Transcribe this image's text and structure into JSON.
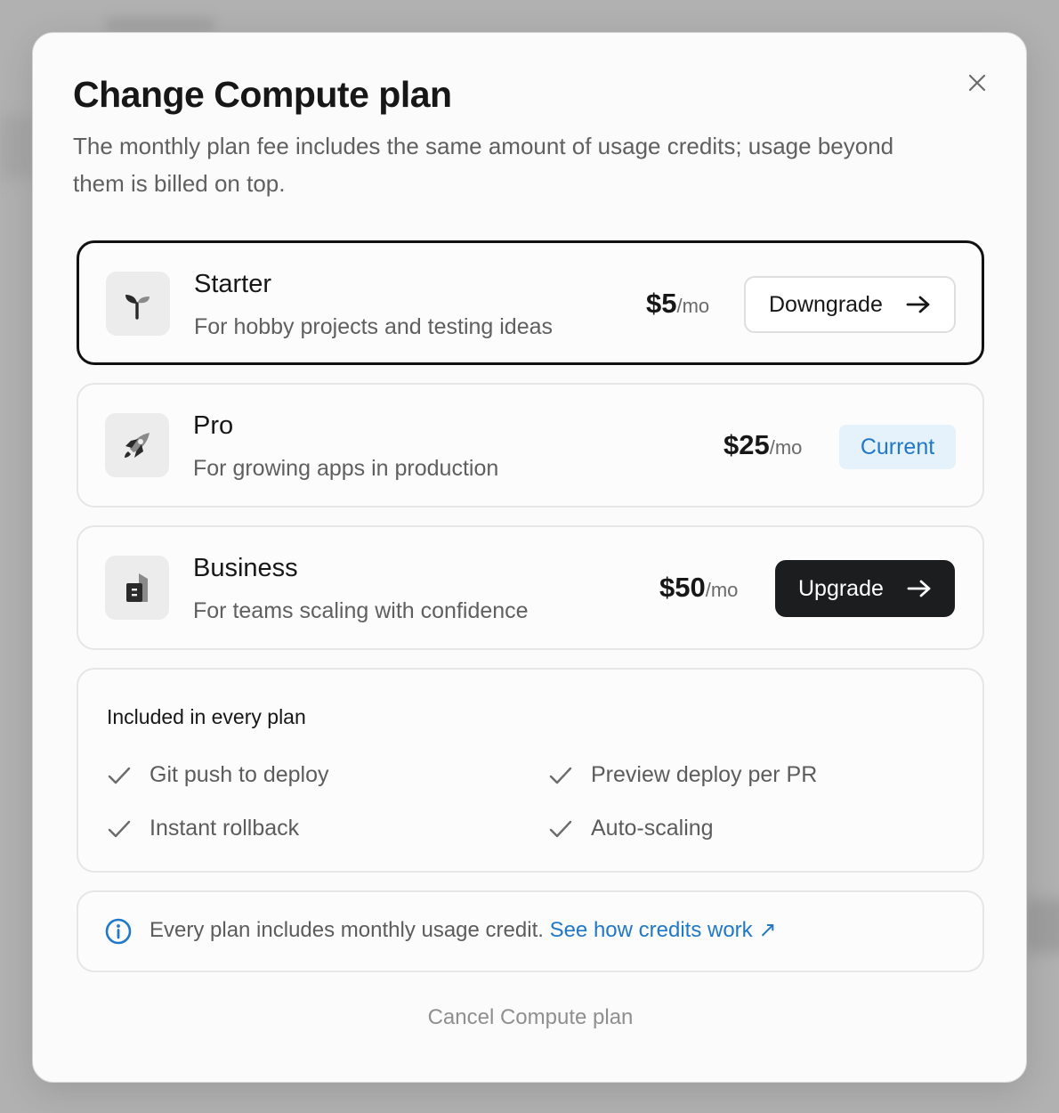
{
  "modal": {
    "title": "Change Compute plan",
    "subtitle": "The monthly plan fee includes the same amount of usage credits; usage beyond them is billed on top.",
    "close_icon": "close-icon"
  },
  "plans": [
    {
      "name": "Starter",
      "description": "For hobby projects and testing ideas",
      "price": "$5",
      "unit": "/mo",
      "action_label": "Downgrade",
      "icon": "sprout-icon",
      "state": "selected"
    },
    {
      "name": "Pro",
      "description": "For growing apps in production",
      "price": "$25",
      "unit": "/mo",
      "badge_label": "Current",
      "icon": "rocket-icon",
      "state": "current"
    },
    {
      "name": "Business",
      "description": "For teams scaling with confidence",
      "price": "$50",
      "unit": "/mo",
      "action_label": "Upgrade",
      "icon": "building-icon",
      "state": "upgrade"
    }
  ],
  "included": {
    "title": "Included in every plan",
    "features": [
      "Git push to deploy",
      "Preview deploy per PR",
      "Instant rollback",
      "Auto-scaling"
    ]
  },
  "info": {
    "text": "Every plan includes monthly usage credit.",
    "link_label": "See how credits work ↗"
  },
  "cancel_label": "Cancel Compute plan",
  "colors": {
    "accent_blue": "#1f78c8",
    "dark_button": "#1c1d1f",
    "current_badge_bg": "#e5f2fb"
  }
}
